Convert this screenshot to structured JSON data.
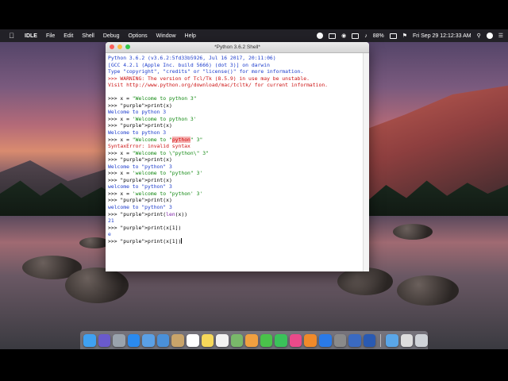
{
  "menubar": {
    "app_name": "IDLE",
    "items": [
      "File",
      "Edit",
      "Shell",
      "Debug",
      "Options",
      "Window",
      "Help"
    ],
    "battery": "88%",
    "datetime": "Fri Sep 29  12:12:33 AM"
  },
  "window": {
    "title": "*Python 3.6.2 Shell*",
    "shell_lines": [
      "Python 3.6.2 (v3.6.2:5fd33b5926, Jul 16 2017, 20:11:06)",
      "[GCC 4.2.1 (Apple Inc. build 5666) (dot 3)] on darwin",
      "Type \"copyright\", \"credits\" or \"license()\" for more information.",
      ">>> WARNING: The version of Tcl/Tk (8.5.9) in use may be unstable.",
      "Visit http://www.python.org/download/mac/tcltk/ for current information.",
      "",
      ">>> x = \"Welcome to python 3\"",
      ">>> print(x)",
      "Welcome to python 3",
      ">>> x = 'Welcome to python 3'",
      ">>> print(x)",
      "Welcome to python 3",
      ">>> x = \"Welcome to \"python\" 3\"",
      "SyntaxError: invalid syntax",
      ">>> x = \"Welcome to \\\"python\\\" 3\"",
      ">>> print(x)",
      "Welcome to \"python\" 3",
      ">>> x = 'welcome to \"python\" 3'",
      ">>> print(x)",
      "welcome to \"python\" 3",
      ">>> x = 'welcome to \"python' 3'",
      ">>> print(x)",
      "welcome to \"python\" 3",
      ">>> print(len(x))",
      "21",
      ">>> print(x[1])",
      "e",
      ">>> print(x[1])"
    ],
    "line_kinds": [
      "out",
      "out",
      "out",
      "warn",
      "warn",
      "blank",
      "in",
      "in",
      "out",
      "in",
      "in",
      "out",
      "errin",
      "err",
      "in",
      "in",
      "out",
      "in",
      "in",
      "out",
      "in",
      "in",
      "out",
      "in",
      "out",
      "in",
      "out",
      "in"
    ]
  },
  "dock": {
    "icons": [
      "finder-icon",
      "siri-icon",
      "launchpad-icon",
      "safari-icon",
      "mail-icon",
      "xcode-icon",
      "contacts-icon",
      "calendar-icon",
      "notes-icon",
      "reminders-icon",
      "maps-icon",
      "photos-icon",
      "messages-icon",
      "facetime-icon",
      "itunes-icon",
      "ibooks-icon",
      "appstore-icon",
      "system-preferences-icon",
      "idle-icon",
      "python-launcher-icon",
      "folder-icon",
      "screenshot-icon",
      "trash-icon"
    ],
    "colors": [
      "#3fa1f2",
      "#6a5acd",
      "#9aa3ad",
      "#2a8af0",
      "#5aa0e6",
      "#4a90d9",
      "#c9a46a",
      "#ffffff",
      "#f6d85a",
      "#f2f2f2",
      "#79b86a",
      "#f0a040",
      "#4ac24a",
      "#3ac25a",
      "#ea4a8a",
      "#f08a2a",
      "#2a7ae8",
      "#8a8a8a",
      "#3a6ac2",
      "#2a5ab2",
      "#5aa6e8",
      "#dddddd",
      "#cfd3d8"
    ]
  }
}
